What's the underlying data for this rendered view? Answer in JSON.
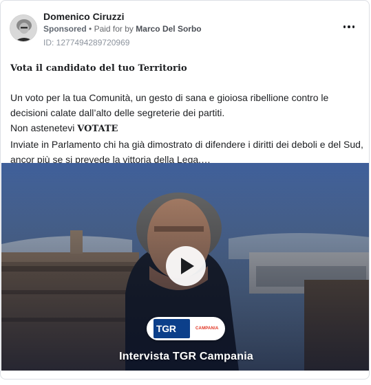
{
  "post": {
    "author": "Domenico Ciruzzi",
    "sponsored_label": "Sponsored",
    "separator": "•",
    "paid_prefix": "Paid for by",
    "paid_by": "Marco Del Sorbo",
    "ad_id": "ID: 1277494289720969",
    "more_icon": "more-horizontal-icon"
  },
  "content": {
    "headline": "Vota il candidato del tuo Territorio",
    "line1": "Un voto per la tua Comunità, un gesto di sana e gioiosa ribellione contro le",
    "line2": "decisioni calate dall’alto delle segreterie dei partiti.",
    "line3_prefix": "Non astenetevi ",
    "line3_bold": "VOTATE",
    "line4": "Inviate in Parlamento chi ha già dimostrato di difendere i diritti dei deboli e del Sud,",
    "line5": "ancor più se si prevede la vittoria della Lega.…"
  },
  "video": {
    "play_icon": "play-icon",
    "logo_text": "TGR",
    "logo_region": "CAMPANIA",
    "caption": "Intervista TGR Campania",
    "colors": {
      "sky": "#5b7db0",
      "logo_blue": "#0c3f8a",
      "logo_red": "#e0301e"
    }
  }
}
